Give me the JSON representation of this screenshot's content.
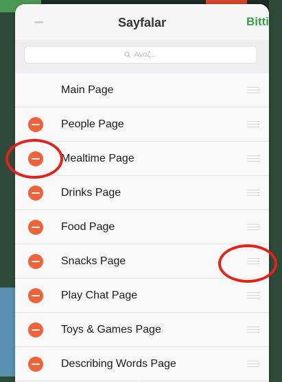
{
  "nav": {
    "title": "Sayfalar",
    "done_label": "Bitti"
  },
  "search": {
    "placeholder": "Αναζ..."
  },
  "pages": [
    {
      "label": "Main Page",
      "deletable": false
    },
    {
      "label": "People Page",
      "deletable": true
    },
    {
      "label": "Mealtime Page",
      "deletable": true
    },
    {
      "label": "Drinks Page",
      "deletable": true
    },
    {
      "label": "Food Page",
      "deletable": true
    },
    {
      "label": "Snacks Page",
      "deletable": true
    },
    {
      "label": "Play Chat Page",
      "deletable": true
    },
    {
      "label": "Toys & Games Page",
      "deletable": true
    },
    {
      "label": "Describing Words Page",
      "deletable": true
    }
  ],
  "colors": {
    "accent_done": "#3aa048",
    "delete_button": "#f0623a",
    "annotation_circle": "#e32219"
  },
  "icons": [
    "minus-icon",
    "search-icon",
    "delete-circle-icon",
    "reorder-grip-icon"
  ]
}
